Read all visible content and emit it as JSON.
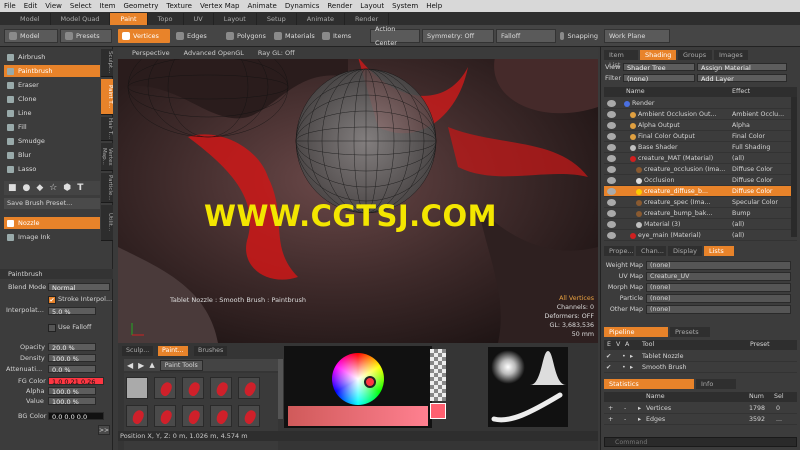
{
  "menu": [
    "File",
    "Edit",
    "View",
    "Select",
    "Item",
    "Geometry",
    "Texture",
    "Vertex Map",
    "Animate",
    "Dynamics",
    "Render",
    "Layout",
    "System",
    "Help"
  ],
  "layout_tabs": [
    {
      "label": "Model",
      "active": false
    },
    {
      "label": "Model Quad",
      "active": false
    },
    {
      "label": "Paint",
      "active": true
    },
    {
      "label": "Topo",
      "active": false
    },
    {
      "label": "UV",
      "active": false
    },
    {
      "label": "Layout",
      "active": false
    },
    {
      "label": "Setup",
      "active": false
    },
    {
      "label": "Animate",
      "active": false
    },
    {
      "label": "Render",
      "active": false
    }
  ],
  "toolbar": {
    "model": "Model",
    "presets": "Presets",
    "vertices": "Vertices",
    "edges": "Edges",
    "polygons": "Polygons",
    "materials": "Materials",
    "items": "Items",
    "action_center": "Action Center",
    "symmetry": "Symmetry: Off",
    "falloff": "Falloff",
    "snapping": "Snapping",
    "work_plane": "Work Plane"
  },
  "brushes": [
    "Airbrush",
    "Paintbrush",
    "Eraser",
    "Clone",
    "Line",
    "Fill",
    "Smudge",
    "Blur",
    "Lasso"
  ],
  "selected_brush": "Paintbrush",
  "side_tabs": [
    "Sculpt...",
    "Paint T...",
    "Hair T...",
    "Vertex Map...",
    "Particle...",
    "Utilit..."
  ],
  "save_brush_preset": "Save Brush Preset...",
  "nozzle": "Nozzle",
  "image_ink": "Image Ink",
  "paintbrush_props": {
    "header": "Paintbrush",
    "blend_mode_label": "Blend Mode",
    "blend_mode": "Normal",
    "stroke_interp": "Stroke Interpol...",
    "interpolation_label": "Interpolat...",
    "interpolation": "5.0 %",
    "use_falloff": "Use Falloff",
    "opacity_label": "Opacity",
    "opacity": "20.0 %",
    "density_label": "Density",
    "density": "100.0 %",
    "atten_label": "Attenuati...",
    "atten": "0.0 %"
  },
  "colors": {
    "fg_label": "FG Color",
    "fg": "1.0  0.21  0.26",
    "alpha_label": "Alpha",
    "alpha": "100.0 %",
    "value_label": "Value",
    "value": "100.0 %",
    "bg_label": "BG Color",
    "bg": "0.0  0.0  0.0",
    "fg_hex": "#ff3642",
    "accent": "#e8832a"
  },
  "viewport": {
    "perspective": "Perspective",
    "advanced": "Advanced OpenGL",
    "ray_gl": "Ray GL: Off",
    "watermark": "WWW.CGTSJ.COM",
    "tool_info": "Tablet Nozzle : Smooth Brush : Paintbrush",
    "all_vertices": "All Vertices",
    "channels": "Channels: 0",
    "deformers": "Deformers: OFF",
    "gl": "GL: 3,683,536",
    "dist": "50 mm"
  },
  "status": "Position X, Y, Z:   0 m, 1.026 m, 4.574 m",
  "shading": {
    "tabs": [
      {
        "label": "Item List",
        "on": false
      },
      {
        "label": "Shading",
        "on": true
      },
      {
        "label": "Groups",
        "on": false
      },
      {
        "label": "Images",
        "on": false
      }
    ],
    "view_label": "View",
    "view": "Shader Tree",
    "assign": "Assign Material",
    "filter_label": "Filter",
    "filter": "(none)",
    "add_layer": "Add Layer",
    "col_name": "Name",
    "col_effect": "Effect",
    "rows": [
      {
        "name": "Render",
        "effect": "",
        "dot": "#4a6fe0",
        "indent": 0,
        "sel": false
      },
      {
        "name": "Ambient Occlusion Out...",
        "effect": "Ambient Occlu...",
        "dot": "#e0a040",
        "indent": 1,
        "sel": false
      },
      {
        "name": "Alpha Output",
        "effect": "Alpha",
        "dot": "#e0a040",
        "indent": 1,
        "sel": false
      },
      {
        "name": "Final Color Output",
        "effect": "Final Color",
        "dot": "#e0a040",
        "indent": 1,
        "sel": false
      },
      {
        "name": "Base Shader",
        "effect": "Full Shading",
        "dot": "#c0c0c0",
        "indent": 1,
        "sel": false
      },
      {
        "name": "creature_MAT (Material)",
        "effect": "(all)",
        "dot": "#d02020",
        "indent": 1,
        "sel": false
      },
      {
        "name": "creature_occlusion (Ima...",
        "effect": "Diffuse Color",
        "dot": "#8a5a30",
        "indent": 2,
        "sel": false
      },
      {
        "name": "Occlusion",
        "effect": "Diffuse Color",
        "dot": "#dddddd",
        "indent": 2,
        "sel": false
      },
      {
        "name": "creature_diffuse_b...",
        "effect": "Diffuse Color",
        "dot": "#ffcc00",
        "indent": 2,
        "sel": true
      },
      {
        "name": "creature_spec (Ima...",
        "effect": "Specular Color",
        "dot": "#8a5a30",
        "indent": 2,
        "sel": false
      },
      {
        "name": "creature_bump_bak...",
        "effect": "Bump",
        "dot": "#8a5a30",
        "indent": 2,
        "sel": false
      },
      {
        "name": "Material (3)",
        "effect": "(all)",
        "dot": "#c0c0c0",
        "indent": 2,
        "sel": false
      },
      {
        "name": "eye_main (Material)",
        "effect": "(all)",
        "dot": "#d02020",
        "indent": 1,
        "sel": false
      }
    ]
  },
  "lists": {
    "tabs": [
      {
        "label": "Prope...",
        "on": false
      },
      {
        "label": "Chan...",
        "on": false
      },
      {
        "label": "Display",
        "on": false
      },
      {
        "label": "Lists",
        "on": true
      }
    ],
    "rows": [
      {
        "label": "Weight Map",
        "value": "(none)"
      },
      {
        "label": "UV Map",
        "value": "Creature_UV"
      },
      {
        "label": "Morph Map",
        "value": "(none)"
      },
      {
        "label": "Particle",
        "value": "(none)"
      },
      {
        "label": "Other Map",
        "value": "(none)"
      }
    ]
  },
  "pipeline": {
    "tabs": [
      {
        "label": "Pipeline",
        "on": true
      },
      {
        "label": "Presets",
        "on": false
      }
    ],
    "cols": [
      "E",
      "V",
      "A",
      "Tool",
      "Preset"
    ],
    "rows": [
      {
        "tool": "Tablet Nozzle"
      },
      {
        "tool": "Smooth Brush"
      }
    ]
  },
  "statistics": {
    "tabs": [
      {
        "label": "Statistics",
        "on": true
      },
      {
        "label": "Info",
        "on": false
      }
    ],
    "cols": [
      "Name",
      "Num",
      "Sel"
    ],
    "rows": [
      {
        "name": "Vertices",
        "num": "1798",
        "sel": "0"
      },
      {
        "name": "Edges",
        "num": "3592",
        "sel": "..."
      }
    ]
  },
  "bottom_tabs": [
    {
      "label": "Sculp...",
      "on": false
    },
    {
      "label": "Paint...",
      "on": true
    },
    {
      "label": "Brushes",
      "on": false
    }
  ],
  "paint_tools": "Paint Tools",
  "command_placeholder": "Command"
}
